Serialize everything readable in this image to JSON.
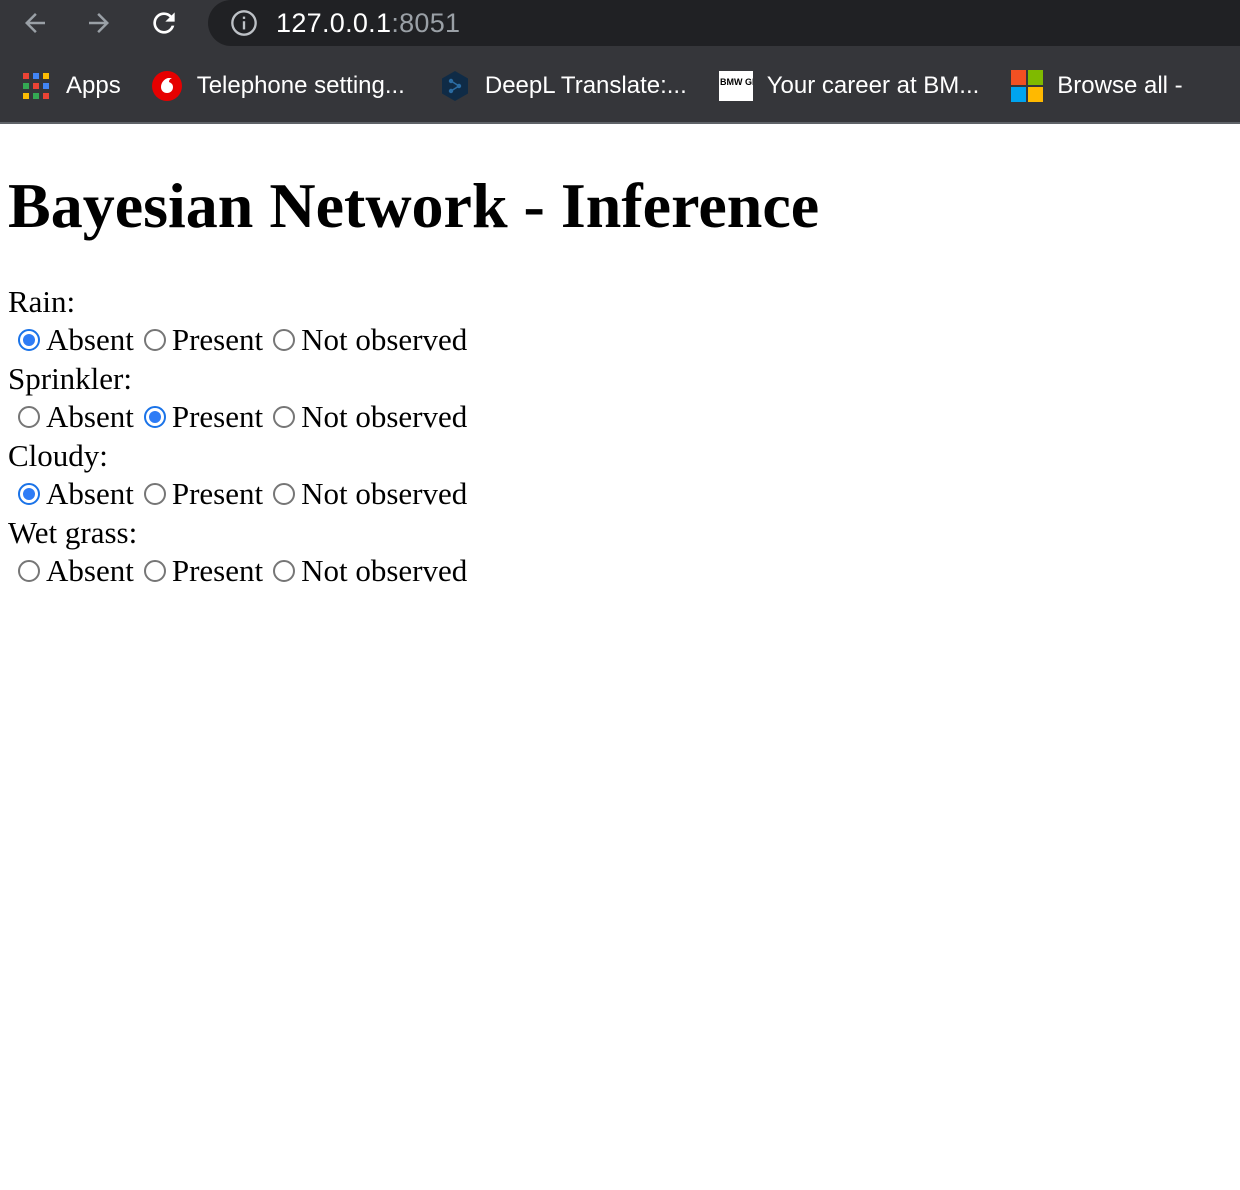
{
  "browser": {
    "url_host": "127.0.0.1",
    "url_port": ":8051",
    "bookmarks": [
      {
        "label": "Apps",
        "icon": "apps-grid-icon"
      },
      {
        "label": "Telephone setting...",
        "icon": "vodafone-icon"
      },
      {
        "label": "DeepL Translate:...",
        "icon": "deepl-icon"
      },
      {
        "label": "Your career at BM...",
        "icon": "bmw-group-icon",
        "icon_text": "BMW GROUP"
      },
      {
        "label": "Browse all -",
        "icon": "microsoft-icon"
      }
    ]
  },
  "page": {
    "title": "Bayesian Network - Inference",
    "variables": [
      {
        "label": "Rain:",
        "options": [
          "Absent",
          "Present",
          "Not observed"
        ],
        "selected": "Absent"
      },
      {
        "label": "Sprinkler:",
        "options": [
          "Absent",
          "Present",
          "Not observed"
        ],
        "selected": "Present"
      },
      {
        "label": "Cloudy:",
        "options": [
          "Absent",
          "Present",
          "Not observed"
        ],
        "selected": "Absent"
      },
      {
        "label": "Wet grass:",
        "options": [
          "Absent",
          "Present",
          "Not observed"
        ],
        "selected": null
      }
    ]
  },
  "colors": {
    "chrome_bg": "#35363a",
    "omnibox_bg": "#202124",
    "radio_checked": "#2e7cf6"
  }
}
